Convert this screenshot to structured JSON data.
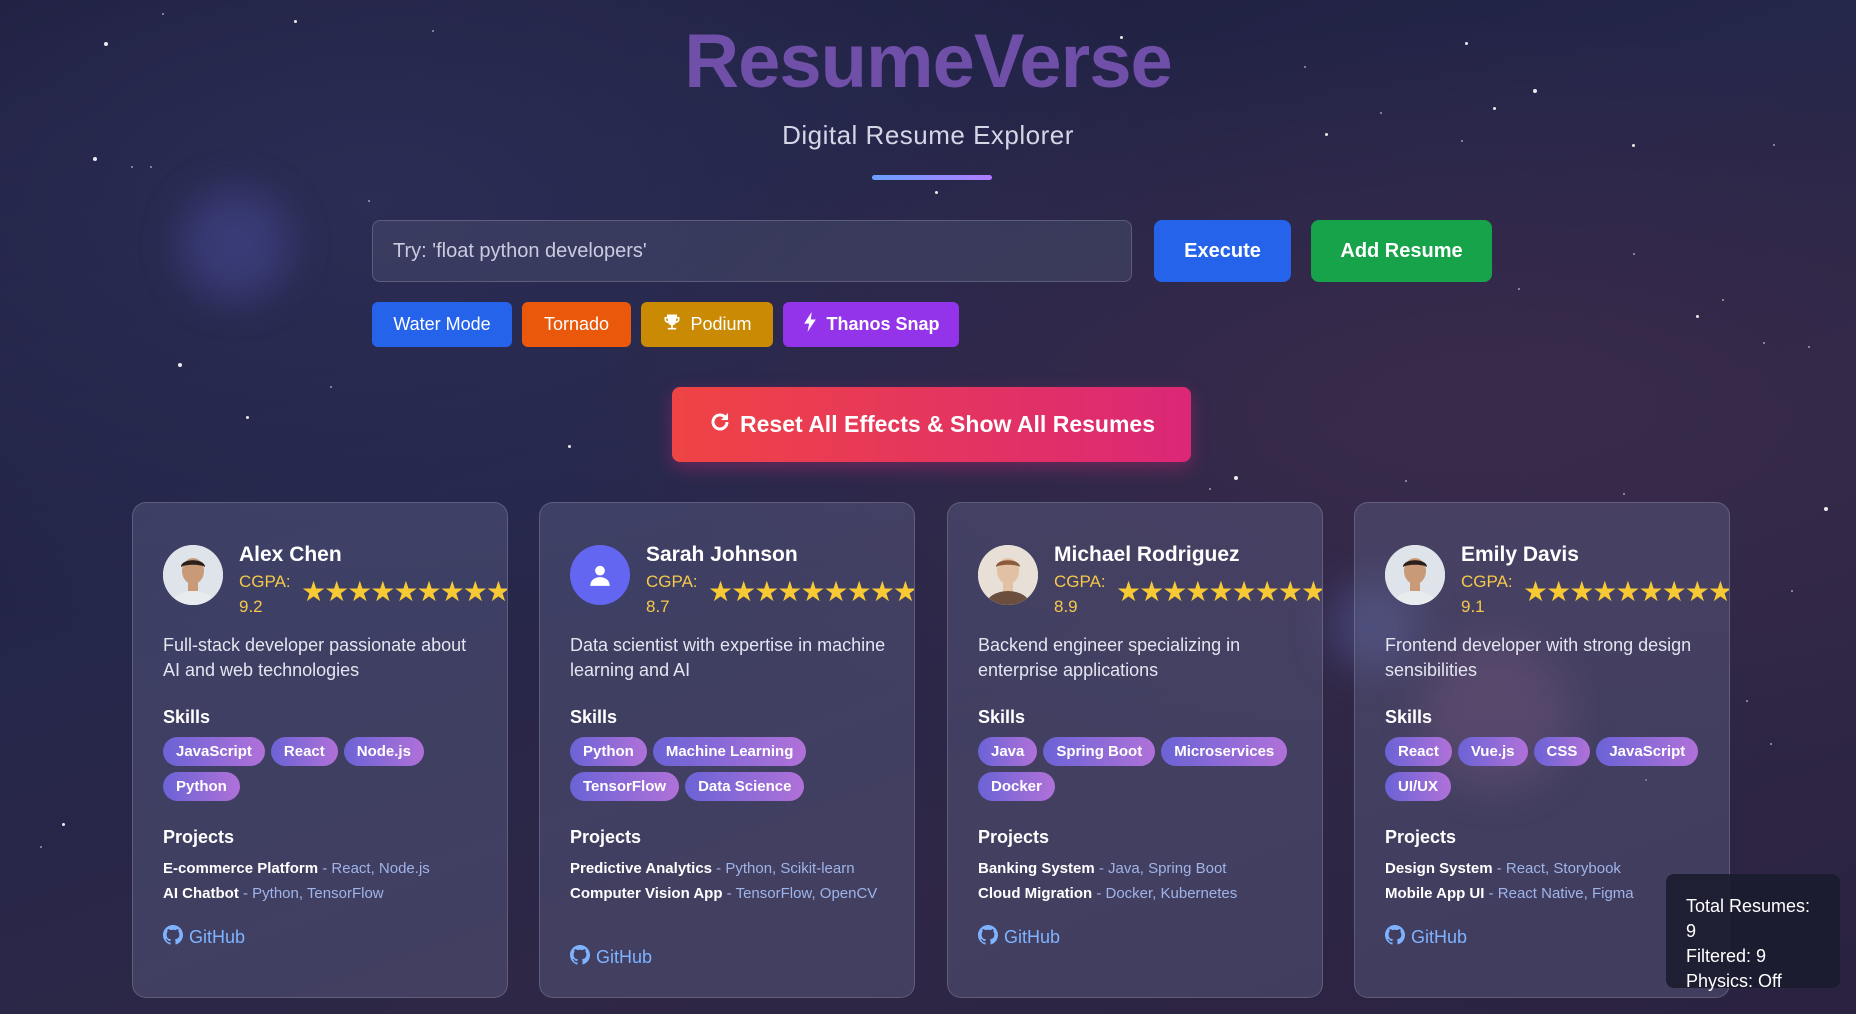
{
  "header": {
    "title": "ResumeVerse",
    "subtitle": "Digital Resume Explorer"
  },
  "search": {
    "placeholder": "Try: 'float python developers'"
  },
  "actions": {
    "execute_label": "Execute",
    "add_label": "Add Resume",
    "reset_label": "Reset All Effects & Show All Resumes"
  },
  "effects": {
    "water": "Water Mode",
    "tornado": "Tornado",
    "podium": "Podium",
    "thanos": "Thanos Snap"
  },
  "colors": {
    "execute": "#2563eb",
    "add": "#16a34a",
    "water": "#2563eb",
    "tornado": "#ea580c",
    "podium": "#ca8a04",
    "thanos": "#9333ea",
    "reset_start": "#ef4444",
    "reset_end": "#db2777"
  },
  "cards": [
    {
      "name": "Alex Chen",
      "cgpa_label": "CGPA:",
      "cgpa": "9.2",
      "rating": "★★★★★★★★★",
      "avatar": "photo",
      "description": "Full-stack developer passionate about AI and web technologies",
      "skills_label": "Skills",
      "skills": [
        "JavaScript",
        "React",
        "Node.js",
        "Python"
      ],
      "projects_label": "Projects",
      "projects": [
        {
          "name": "E-commerce Platform",
          "tech": " - React, Node.js"
        },
        {
          "name": "AI Chatbot",
          "tech": " - Python, TensorFlow"
        }
      ],
      "github": "GitHub"
    },
    {
      "name": "Sarah Johnson",
      "cgpa_label": "CGPA:",
      "cgpa": "8.7",
      "rating": "★★★★★★★★★",
      "avatar": "user-icon",
      "description": "Data scientist with expertise in machine learning and AI",
      "skills_label": "Skills",
      "skills": [
        "Python",
        "Machine Learning",
        "TensorFlow",
        "Data Science"
      ],
      "projects_label": "Projects",
      "projects": [
        {
          "name": "Predictive Analytics",
          "tech": " - Python, Scikit-learn"
        },
        {
          "name": "Computer Vision App",
          "tech": " - TensorFlow, OpenCV"
        }
      ],
      "github": "GitHub"
    },
    {
      "name": "Michael Rodriguez",
      "cgpa_label": "CGPA:",
      "cgpa": "8.9",
      "rating": "★★★★★★★★★",
      "avatar": "photo",
      "description": "Backend engineer specializing in enterprise applications",
      "skills_label": "Skills",
      "skills": [
        "Java",
        "Spring Boot",
        "Microservices",
        "Docker"
      ],
      "projects_label": "Projects",
      "projects": [
        {
          "name": "Banking System",
          "tech": " - Java, Spring Boot"
        },
        {
          "name": "Cloud Migration",
          "tech": " - Docker, Kubernetes"
        }
      ],
      "github": "GitHub"
    },
    {
      "name": "Emily Davis",
      "cgpa_label": "CGPA:",
      "cgpa": "9.1",
      "rating": "★★★★★★★★★",
      "avatar": "photo",
      "description": "Frontend developer with strong design sensibilities",
      "skills_label": "Skills",
      "skills": [
        "React",
        "Vue.js",
        "CSS",
        "JavaScript",
        "UI/UX"
      ],
      "projects_label": "Projects",
      "projects": [
        {
          "name": "Design System",
          "tech": " - React, Storybook"
        },
        {
          "name": "Mobile App UI",
          "tech": " - React Native, Figma"
        }
      ],
      "github": "GitHub"
    }
  ],
  "stats": {
    "total": "Total Resumes: 9",
    "filtered": "Filtered: 9",
    "physics": "Physics: Off"
  }
}
